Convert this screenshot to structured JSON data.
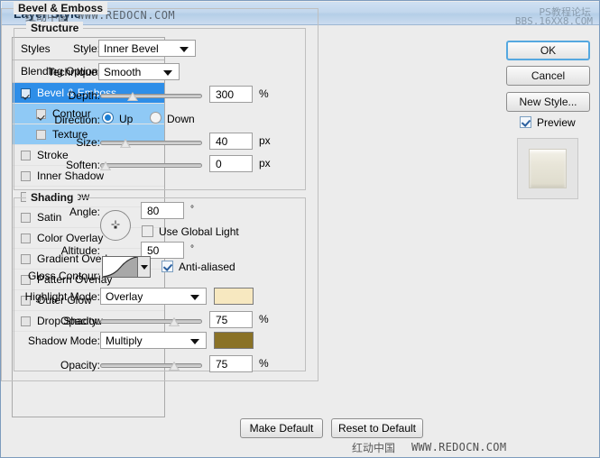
{
  "window": {
    "title": "Layer Style"
  },
  "watermarks": {
    "title_cn": "红动中国",
    "title_en": "WWW.REDOCN.COM",
    "top_right_1": "PS教程论坛",
    "top_right_2": "BBS.16XX8.COM",
    "bottom_cn": "红动中国",
    "bottom_en": "WWW.REDOCN.COM"
  },
  "styles_panel": {
    "header": "Styles",
    "blending_options": "Blending Options:Custom",
    "items": [
      {
        "label": "Bevel & Emboss",
        "checked": true,
        "selected": true,
        "sub": false
      },
      {
        "label": "Contour",
        "checked": true,
        "selected": false,
        "sub": true
      },
      {
        "label": "Texture",
        "checked": false,
        "selected": false,
        "sub": true
      },
      {
        "label": "Stroke",
        "checked": false,
        "selected": false,
        "sub": false
      },
      {
        "label": "Inner Shadow",
        "checked": false,
        "selected": false,
        "sub": false
      },
      {
        "label": "Inner Glow",
        "checked": false,
        "selected": false,
        "sub": false
      },
      {
        "label": "Satin",
        "checked": false,
        "selected": false,
        "sub": false
      },
      {
        "label": "Color Overlay",
        "checked": false,
        "selected": false,
        "sub": false
      },
      {
        "label": "Gradient Overlay",
        "checked": false,
        "selected": false,
        "sub": false
      },
      {
        "label": "Pattern Overlay",
        "checked": false,
        "selected": false,
        "sub": false
      },
      {
        "label": "Outer Glow",
        "checked": false,
        "selected": false,
        "sub": false
      },
      {
        "label": "Drop Shadow",
        "checked": false,
        "selected": false,
        "sub": false
      }
    ]
  },
  "main": {
    "group_title": "Bevel & Emboss",
    "structure": {
      "title": "Structure",
      "style_label": "Style:",
      "style_value": "Inner Bevel",
      "technique_label": "Technique:",
      "technique_value": "Smooth",
      "depth_label": "Depth:",
      "depth_value": "300",
      "depth_unit": "%",
      "depth_pct": 30,
      "direction_label": "Direction:",
      "direction_up": "Up",
      "direction_down": "Down",
      "direction_selected": "Up",
      "size_label": "Size:",
      "size_value": "40",
      "size_unit": "px",
      "size_pct": 22,
      "soften_label": "Soften:",
      "soften_value": "0",
      "soften_unit": "px",
      "soften_pct": 0
    },
    "shading": {
      "title": "Shading",
      "angle_label": "Angle:",
      "angle_value": "80",
      "angle_unit": "°",
      "use_global_light_label": "Use Global Light",
      "use_global_light_checked": false,
      "altitude_label": "Altitude:",
      "altitude_value": "50",
      "altitude_unit": "°",
      "gloss_contour_label": "Gloss Contour:",
      "anti_aliased_label": "Anti-aliased",
      "anti_aliased_checked": true,
      "highlight_mode_label": "Highlight Mode:",
      "highlight_mode_value": "Overlay",
      "highlight_color": "#f7e8c0",
      "highlight_opacity_label": "Opacity:",
      "highlight_opacity_value": "75",
      "highlight_opacity_unit": "%",
      "highlight_opacity_pct": 75,
      "shadow_mode_label": "Shadow Mode:",
      "shadow_mode_value": "Multiply",
      "shadow_color": "#8a7226",
      "shadow_opacity_label": "Opacity:",
      "shadow_opacity_value": "75",
      "shadow_opacity_unit": "%",
      "shadow_opacity_pct": 75
    }
  },
  "buttons": {
    "ok": "OK",
    "cancel": "Cancel",
    "new_style": "New Style...",
    "preview": "Preview",
    "preview_checked": true,
    "make_default": "Make Default",
    "reset_to_default": "Reset to Default"
  },
  "colors": {
    "selection_blue": "#2e8ee8",
    "sub_selection_blue": "#8fc9f5",
    "dialog_bg": "#ececec",
    "focus_ring": "#55a8e0"
  }
}
